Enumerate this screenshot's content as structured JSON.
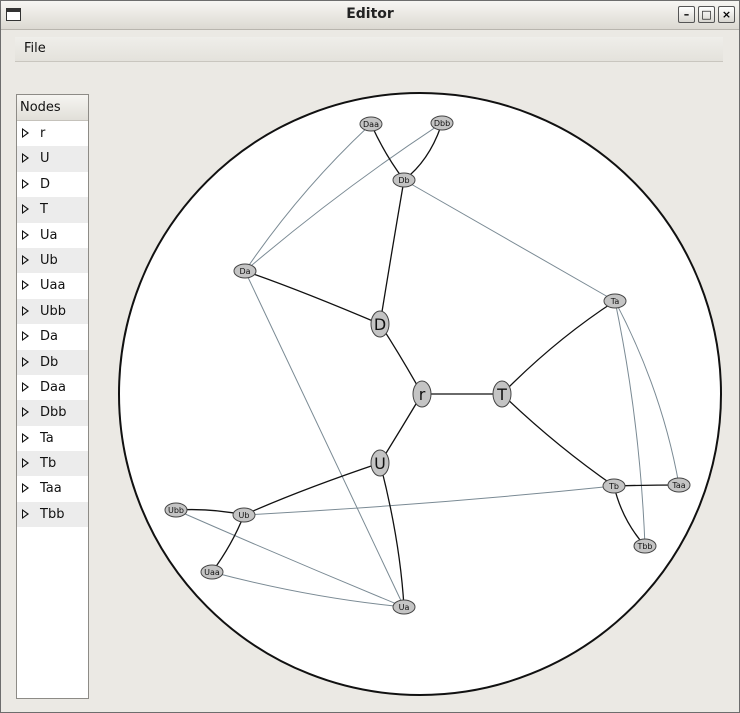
{
  "window": {
    "title": "Editor"
  },
  "menu": {
    "file": "File"
  },
  "tree": {
    "header": "Nodes",
    "items": [
      "r",
      "U",
      "D",
      "T",
      "Ua",
      "Ub",
      "Uaa",
      "Ubb",
      "Da",
      "Db",
      "Daa",
      "Dbb",
      "Ta",
      "Tb",
      "Taa",
      "Tbb"
    ]
  },
  "graph": {
    "nodes": [
      {
        "id": "r",
        "label": "r",
        "size": "large"
      },
      {
        "id": "U",
        "label": "U",
        "size": "large"
      },
      {
        "id": "D",
        "label": "D",
        "size": "large"
      },
      {
        "id": "T",
        "label": "T",
        "size": "large"
      },
      {
        "id": "Ua",
        "label": "Ua",
        "size": "small"
      },
      {
        "id": "Ub",
        "label": "Ub",
        "size": "small"
      },
      {
        "id": "Uaa",
        "label": "Uaa",
        "size": "small"
      },
      {
        "id": "Ubb",
        "label": "Ubb",
        "size": "small"
      },
      {
        "id": "Da",
        "label": "Da",
        "size": "small"
      },
      {
        "id": "Db",
        "label": "Db",
        "size": "small"
      },
      {
        "id": "Daa",
        "label": "Daa",
        "size": "small"
      },
      {
        "id": "Dbb",
        "label": "Dbb",
        "size": "small"
      },
      {
        "id": "Ta",
        "label": "Ta",
        "size": "small"
      },
      {
        "id": "Tb",
        "label": "Tb",
        "size": "small"
      },
      {
        "id": "Taa",
        "label": "Taa",
        "size": "small"
      },
      {
        "id": "Tbb",
        "label": "Tbb",
        "size": "small"
      }
    ],
    "tree_edges": [
      [
        "r",
        "D"
      ],
      [
        "r",
        "T"
      ],
      [
        "r",
        "U"
      ],
      [
        "D",
        "Da"
      ],
      [
        "D",
        "Db"
      ],
      [
        "Db",
        "Daa"
      ],
      [
        "Db",
        "Dbb"
      ],
      [
        "T",
        "Ta"
      ],
      [
        "T",
        "Tb"
      ],
      [
        "Tb",
        "Taa"
      ],
      [
        "Tb",
        "Tbb"
      ],
      [
        "U",
        "Ub"
      ],
      [
        "U",
        "Ua"
      ],
      [
        "Ub",
        "Uaa"
      ],
      [
        "Ub",
        "Ubb"
      ]
    ],
    "cross_edges": [
      [
        "Da",
        "Daa"
      ],
      [
        "Da",
        "Dbb"
      ],
      [
        "Db",
        "Ta"
      ],
      [
        "Ta",
        "Taa"
      ],
      [
        "Ta",
        "Tbb"
      ],
      [
        "Ub",
        "Tb"
      ],
      [
        "Da",
        "Ua"
      ],
      [
        "Ubb",
        "Ua"
      ],
      [
        "Uaa",
        "Ua"
      ]
    ],
    "colors": {
      "tree_edge": "#111111",
      "cross_edge": "#7a8a94",
      "node_fill": "#c4c4c4",
      "node_stroke": "#444444"
    }
  }
}
